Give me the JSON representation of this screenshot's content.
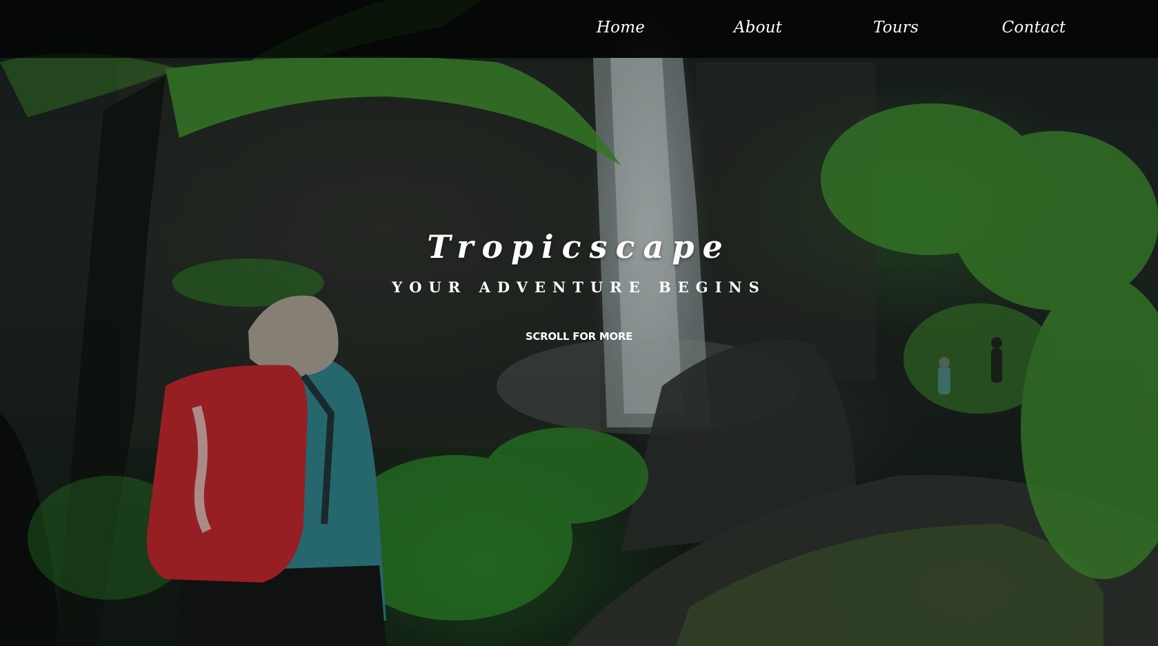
{
  "nav": {
    "items": [
      {
        "label": "Home"
      },
      {
        "label": "About"
      },
      {
        "label": "Tours"
      },
      {
        "label": "Contact"
      }
    ]
  },
  "hero": {
    "title": "Tropicscape",
    "subtitle": "YOUR ADVENTURE BEGINS",
    "scroll_label": "SCROLL FOR MORE",
    "background_description_colors": {
      "foliage": "#3f8f2e",
      "waterfall": "#c9d4d4",
      "backpack": "#b8262b",
      "jacket": "#3a8f98"
    }
  }
}
